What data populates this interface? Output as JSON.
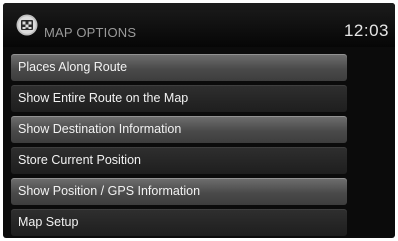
{
  "header": {
    "icon": "map-options-icon",
    "title": "MAP OPTIONS",
    "clock": "12:03"
  },
  "menu": {
    "items": [
      {
        "label": "Places Along Route",
        "style": "light"
      },
      {
        "label": "Show Entire Route on the Map",
        "style": "dark"
      },
      {
        "label": "Show Destination Information",
        "style": "light"
      },
      {
        "label": "Store Current Position",
        "style": "dark"
      },
      {
        "label": "Show Position / GPS Information",
        "style": "light"
      },
      {
        "label": "Map Setup",
        "style": "dark"
      }
    ]
  }
}
